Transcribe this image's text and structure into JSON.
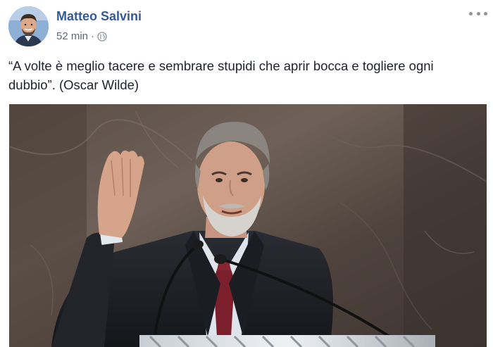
{
  "post": {
    "author_name": "Matteo Salvini",
    "timestamp": "52 min",
    "separator": "·",
    "audience_icon": "globe-icon",
    "more_icon": "more-options-icon",
    "text_line1": "“A volte è meglio tacere e sembrare stupidi che aprir bocca e togliere ogni",
    "text_line2": "dubbio”. (Oscar Wilde)"
  },
  "colors": {
    "author_link": "#365899",
    "meta_text": "#616770",
    "body_text": "#1d2129"
  }
}
